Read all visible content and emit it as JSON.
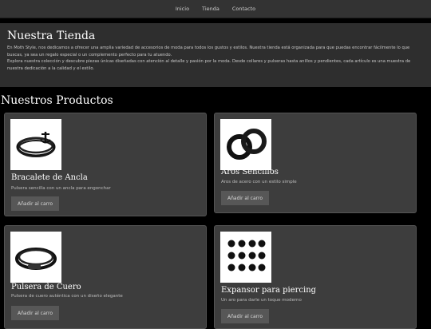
{
  "nav": {
    "links": [
      "Inicio",
      "Tienda",
      "Contacto"
    ]
  },
  "hero": {
    "title": "Nuestra Tienda",
    "paragraph1": "En Moth Style, nos dedicamos a ofrecer una amplia variedad de accesorios de moda para todos los gustos y estilos. Nuestra tienda está organizada para que puedas encontrar fácilmente lo que buscas, ya sea un regalo especial o un complemento perfecto para tu atuendo.",
    "paragraph2": "Explora nuestra colección y descubre piezas únicas diseñadas con atención al detalle y pasión por la moda. Desde collares y pulseras hasta anillos y pendientes, cada artículo es una muestra de nuestra dedicación a la calidad y el estilo."
  },
  "products_title": "Nuestros Productos",
  "products": [
    {
      "name": "Bracalete de Ancla",
      "description": "Pulsera sencilla con un ancla para engonchar",
      "button": "Añadir al carro",
      "icon": "bracelet-icon"
    },
    {
      "name": "Aros Sencillos",
      "description": "Aros de acero con un estilo simple",
      "button": "Añadir al carro",
      "icon": "earrings-icon"
    },
    {
      "name": "Pulsera de Cuero",
      "description": "Pulsera de cuero auténtica con un diseño elegante",
      "button": "Añadir al carro",
      "icon": "bracelet-icon"
    },
    {
      "name": "Expansor para piercing",
      "description": "Un aro para darle un toque moderno",
      "button": "Añadir al carro",
      "icon": "piercing-icon"
    }
  ],
  "colors": {
    "background": "#000000",
    "card": "#3d3d3d",
    "nav": "#333333",
    "button": "#575757"
  }
}
